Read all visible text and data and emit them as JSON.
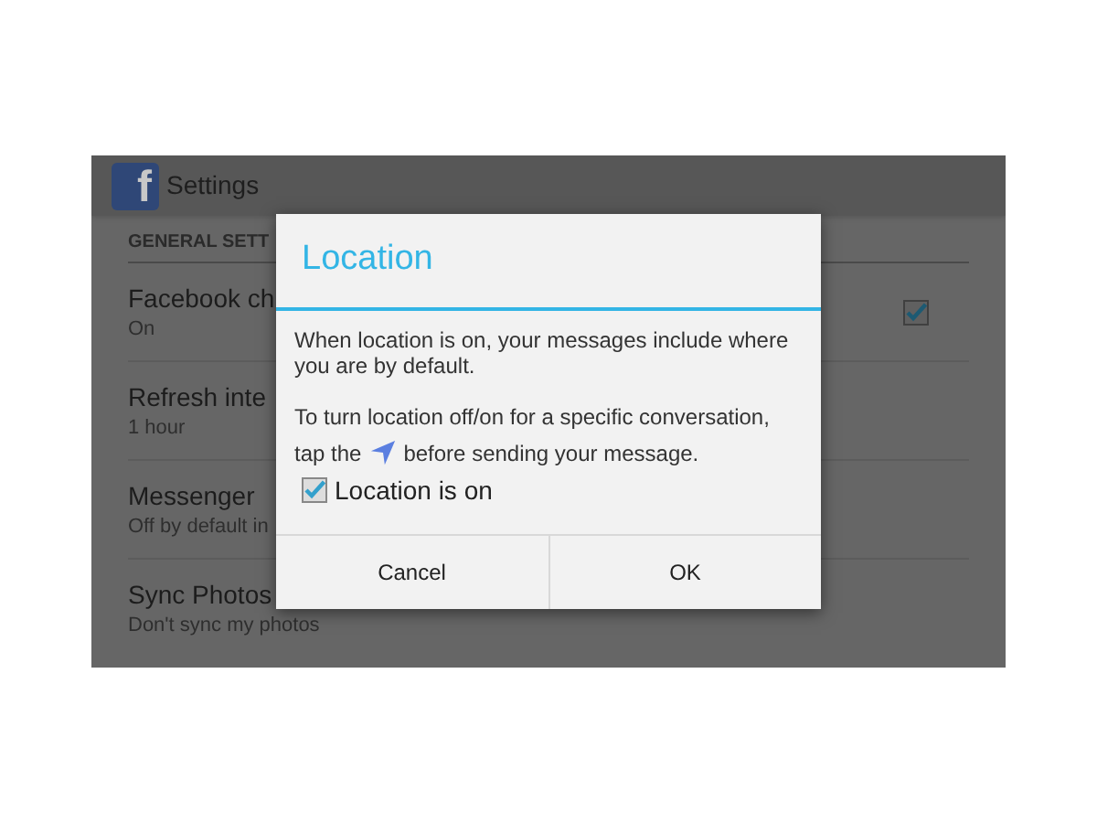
{
  "action_bar": {
    "logo": "f",
    "title": "Settings"
  },
  "section_header": "GENERAL SETT",
  "settings": [
    {
      "title": "Facebook ch",
      "summary": "On",
      "kind": "checkbox",
      "checked": true
    },
    {
      "title": "Refresh inte",
      "summary": "1 hour",
      "kind": "plain"
    },
    {
      "title": "Messenger",
      "summary": "Off by default in",
      "kind": "plain"
    },
    {
      "title": "Sync Photos",
      "summary": "Don't sync my photos",
      "kind": "plain"
    }
  ],
  "dialog": {
    "title": "Location",
    "message": "When location is on, your messages include where you are by default.",
    "hint_before": "To turn location off/on for a specific conversation,",
    "hint_tap": "tap the",
    "hint_after": "before sending your message.",
    "checkbox": {
      "label": "Location is on",
      "checked": true
    },
    "buttons": [
      "Cancel",
      "OK"
    ]
  }
}
